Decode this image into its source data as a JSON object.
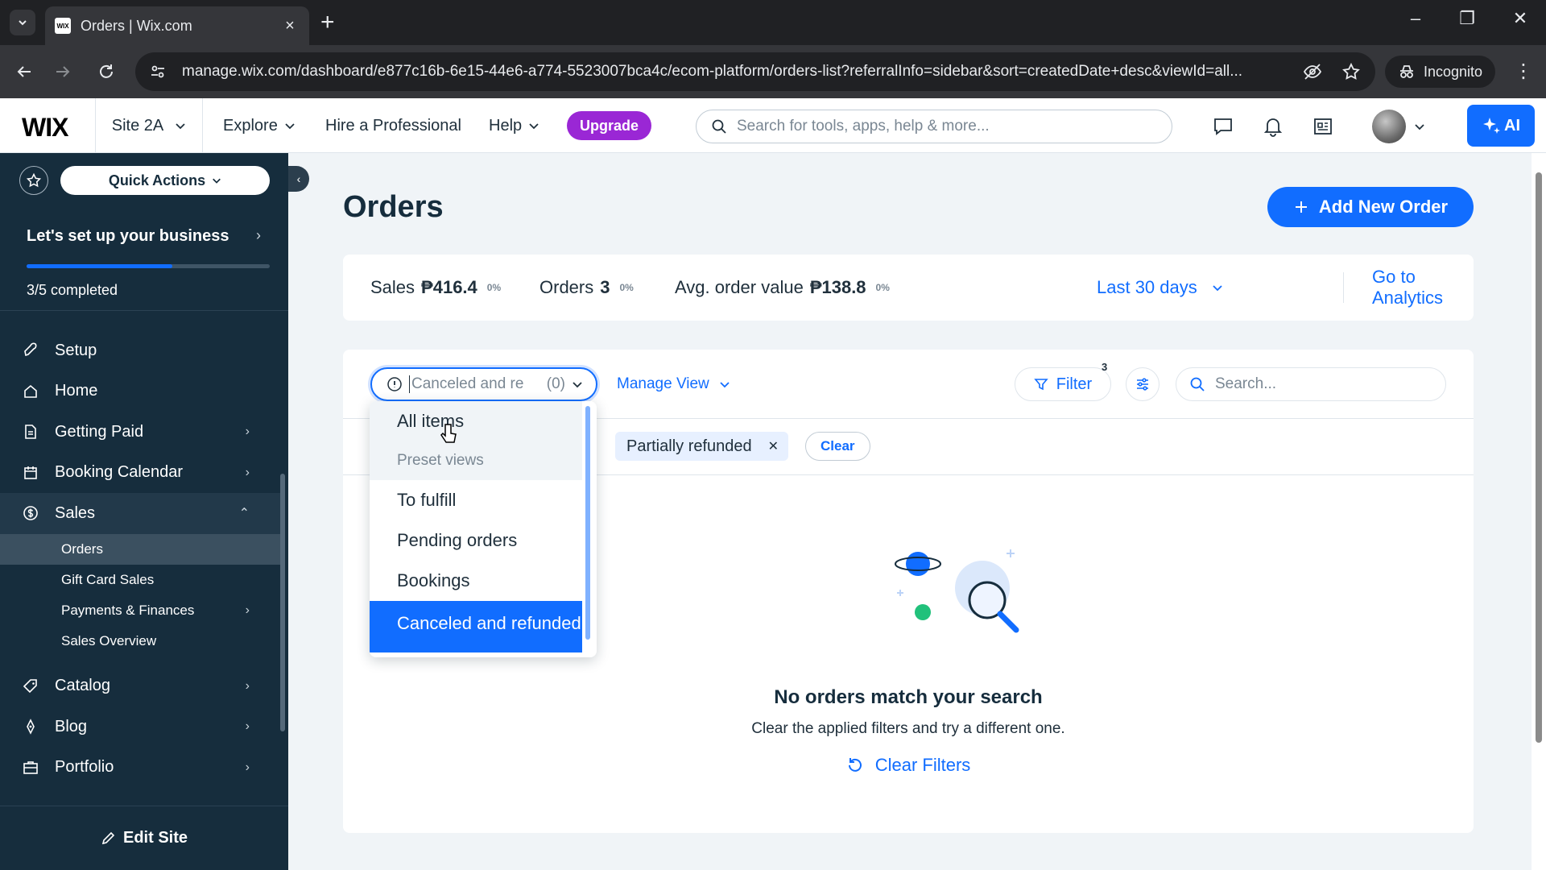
{
  "browser": {
    "tab_title": "Orders | Wix.com",
    "tab_favicon": "WIX",
    "new_tab": "+",
    "url": "manage.wix.com/dashboard/e877c16b-6e15-44e6-a774-5523007bca4c/ecom-platform/orders-list?referralInfo=sidebar&sort=createdDate+desc&viewId=all...",
    "incognito_label": "Incognito"
  },
  "topbar": {
    "logo": "WIX",
    "site_name": "Site 2A",
    "explore": "Explore",
    "hire": "Hire a Professional",
    "help": "Help",
    "upgrade": "Upgrade",
    "search_placeholder": "Search for tools, apps, help & more...",
    "ai_label": "AI"
  },
  "sidebar": {
    "quick_actions": "Quick Actions",
    "setup_title": "Let's set up your business",
    "setup_status": "3/5 completed",
    "setup_progress": 0.6,
    "items": [
      {
        "label": "Setup",
        "icon": "rocket-icon",
        "chevron": false
      },
      {
        "label": "Home",
        "icon": "home-icon",
        "chevron": false
      },
      {
        "label": "Getting Paid",
        "icon": "document-icon",
        "chevron": true
      },
      {
        "label": "Booking Calendar",
        "icon": "calendar-icon",
        "chevron": true
      },
      {
        "label": "Sales",
        "icon": "dollar-icon",
        "chevron": true,
        "expanded": true
      }
    ],
    "sales_sub": [
      {
        "label": "Orders",
        "active": true
      },
      {
        "label": "Gift Card Sales"
      },
      {
        "label": "Payments & Finances",
        "chevron": true
      },
      {
        "label": "Sales Overview"
      }
    ],
    "items_after": [
      {
        "label": "Catalog",
        "icon": "tag-icon"
      },
      {
        "label": "Blog",
        "icon": "pen-icon"
      },
      {
        "label": "Portfolio",
        "icon": "portfolio-icon"
      }
    ],
    "edit_site": "Edit Site"
  },
  "main": {
    "title": "Orders",
    "add_button": "Add New Order",
    "stats": [
      {
        "label": "Sales",
        "value": "₱416.4",
        "pct": "0%"
      },
      {
        "label": "Orders",
        "value": "3",
        "pct": "0%"
      },
      {
        "label": "Avg. order value",
        "value": "₱138.8",
        "pct": "0%"
      }
    ],
    "range": "Last 30 days",
    "analytics_link": "Go to Analytics",
    "view_select_value": "Canceled and re",
    "view_select_count": "(0)",
    "manage_view": "Manage View",
    "filter": "Filter",
    "filter_count": "3",
    "search_placeholder": "Search...",
    "chip": "Partially refunded",
    "chip_clear": "Clear",
    "empty_title": "No orders match your search",
    "empty_sub": "Clear the applied filters and try a different one.",
    "clear_filters": "Clear Filters"
  },
  "dropdown": {
    "all_items": "All items",
    "preset_header": "Preset views",
    "options": [
      "To fulfill",
      "Pending orders",
      "Bookings"
    ],
    "selected": "Canceled and refunded"
  },
  "colors": {
    "accent": "#116dff",
    "sidebar_bg": "#162d3d",
    "upgrade": "#9a27d5"
  }
}
